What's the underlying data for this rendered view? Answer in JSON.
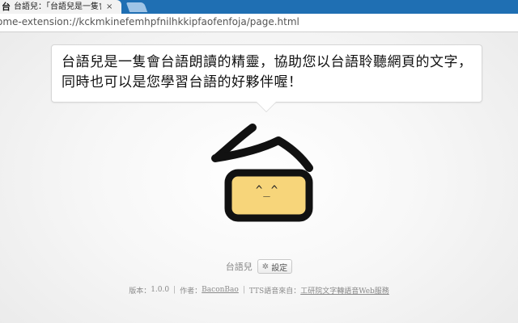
{
  "browser": {
    "tab": {
      "favicon_text": "台",
      "title": "台語兒：「台語兒是一隻會台語朗讀的精靈」",
      "close": "×"
    },
    "url": "ome-extension://kckmkinefemhpfnilhkkipfaofenfoja/page.html"
  },
  "bubble": {
    "text": "台語兒是一隻會台語朗讀的精靈，協助您以台語聆聽網頁的文字，同時也可以是您學習台語的好夥伴喔！"
  },
  "mascot": {
    "face": "^_^",
    "colors": {
      "stroke": "#111111",
      "screen": "#f7d57a"
    }
  },
  "footer": {
    "app_name": "台語兒",
    "settings_label": "設定",
    "settings_icon": "gear-icon",
    "version_label": "版本：",
    "version": "1.0.0",
    "author_label": "作者：",
    "author": "BaconBao",
    "tts_label": "TTS語音來自：",
    "tts_source": "工研院文字轉語音Web服務"
  }
}
